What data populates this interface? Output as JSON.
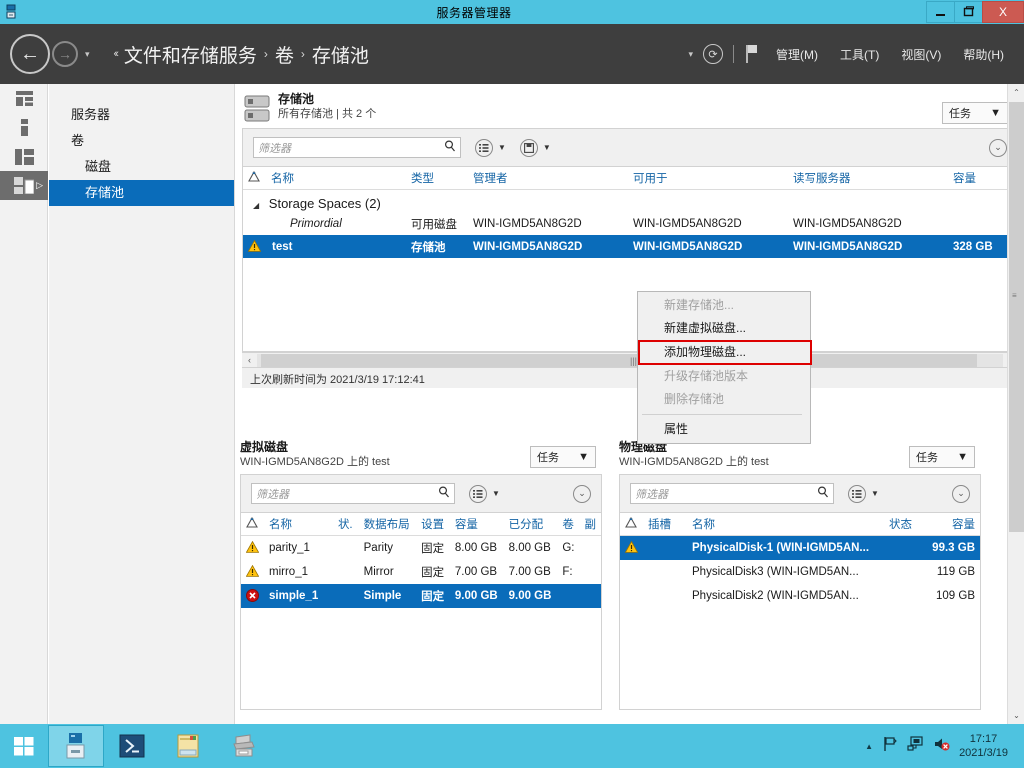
{
  "window": {
    "title": "服务器管理器",
    "minimize_label": "—",
    "restore_label": "❐",
    "close_label": "X"
  },
  "nav": {
    "back_label": "←",
    "forward_label": "→",
    "dropdown_label": "▾",
    "breadcrumb_lead": "‹‹",
    "breadcrumb": [
      "文件和存储服务",
      "卷",
      "存储池"
    ],
    "separator": "›",
    "refresh_label": "⟳",
    "menus": [
      "管理(M)",
      "工具(T)",
      "视图(V)",
      "帮助(H)"
    ]
  },
  "sidebar": {
    "items": [
      {
        "label": "服务器",
        "indent": false,
        "selected": false
      },
      {
        "label": "卷",
        "indent": false,
        "selected": false
      },
      {
        "label": "磁盘",
        "indent": true,
        "selected": false
      },
      {
        "label": "存储池",
        "indent": true,
        "selected": true
      }
    ]
  },
  "pools_panel": {
    "title": "存储池",
    "subtitle": "所有存储池 | 共 2 个",
    "task_label": "任务",
    "task_caret": "▼",
    "filter_placeholder": "筛选器",
    "search_icon": "⌕",
    "columns": [
      "名称",
      "类型",
      "管理者",
      "可用于",
      "读写服务器",
      "容量"
    ],
    "group_row": "Storage Spaces (2)",
    "group_caret": "◢",
    "rows": [
      {
        "name": "Primordial",
        "type": "可用磁盘",
        "manager": "WIN-IGMD5AN8G2D",
        "available_for": "WIN-IGMD5AN8G2D",
        "rw_server": "WIN-IGMD5AN8G2D",
        "capacity": "",
        "status": "none",
        "italic": true,
        "selected": false
      },
      {
        "name": "test",
        "type": "存储池",
        "manager": "WIN-IGMD5AN8G2D",
        "available_for": "WIN-IGMD5AN8G2D",
        "rw_server": "WIN-IGMD5AN8G2D",
        "capacity": "328 GB",
        "status": "warning",
        "italic": false,
        "selected": true
      }
    ],
    "status_text": "上次刷新时间为 2021/3/19 17:12:41"
  },
  "context_menu": {
    "items": [
      {
        "label": "新建存储池...",
        "disabled": true,
        "highlighted": false
      },
      {
        "label": "新建虚拟磁盘...",
        "disabled": false,
        "highlighted": false
      },
      {
        "label": "添加物理磁盘...",
        "disabled": false,
        "highlighted": true
      },
      {
        "label": "升级存储池版本",
        "disabled": true,
        "highlighted": false
      },
      {
        "label": "删除存储池",
        "disabled": true,
        "highlighted": false
      },
      {
        "separator": true
      },
      {
        "label": "属性",
        "disabled": false,
        "highlighted": false
      }
    ]
  },
  "vdisk_panel": {
    "title": "虚拟磁盘",
    "subtitle": "WIN-IGMD5AN8G2D 上的 test",
    "task_label": "任务",
    "task_caret": "▼",
    "filter_placeholder": "筛选器",
    "columns": [
      "名称",
      "状.",
      "数据布局",
      "设置",
      "容量",
      "已分配",
      "卷",
      "副"
    ],
    "rows": [
      {
        "name": "parity_1",
        "state": "",
        "layout": "Parity",
        "provision": "固定",
        "capacity": "8.00 GB",
        "allocated": "8.00 GB",
        "volume": "G:",
        "status": "warning",
        "selected": false
      },
      {
        "name": "mirro_1",
        "state": "",
        "layout": "Mirror",
        "provision": "固定",
        "capacity": "7.00 GB",
        "allocated": "7.00 GB",
        "volume": "F:",
        "status": "warning",
        "selected": false
      },
      {
        "name": "simple_1",
        "state": "",
        "layout": "Simple",
        "provision": "固定",
        "capacity": "9.00 GB",
        "allocated": "9.00 GB",
        "volume": "",
        "status": "error",
        "selected": true
      }
    ]
  },
  "pdisk_panel": {
    "title": "物理磁盘",
    "subtitle": "WIN-IGMD5AN8G2D 上的 test",
    "task_label": "任务",
    "task_caret": "▼",
    "filter_placeholder": "筛选器",
    "columns": [
      "插槽",
      "名称",
      "状态",
      "容量"
    ],
    "rows": [
      {
        "slot": "",
        "name": "PhysicalDisk-1 (WIN-IGMD5AN...",
        "state": "",
        "capacity": "99.3 GB",
        "status": "warning",
        "selected": true
      },
      {
        "slot": "",
        "name": "PhysicalDisk3 (WIN-IGMD5AN...",
        "state": "",
        "capacity": "119 GB",
        "status": "none",
        "selected": false
      },
      {
        "slot": "",
        "name": "PhysicalDisk2 (WIN-IGMD5AN...",
        "state": "",
        "capacity": "109 GB",
        "status": "none",
        "selected": false
      }
    ]
  },
  "taskbar": {
    "start_label": "⊞",
    "clock_time": "17:17",
    "clock_date": "2021/3/19",
    "tray_up_label": "▲"
  },
  "colors": {
    "accent_blue": "#0a6cba",
    "title_cyan": "#4ec3e0",
    "nav_dark": "#3e3e3e",
    "highlight_red": "#dd0000",
    "warning_yellow": "#ffc20e",
    "error_red": "#cc1111",
    "header_link": "#1464a5"
  }
}
